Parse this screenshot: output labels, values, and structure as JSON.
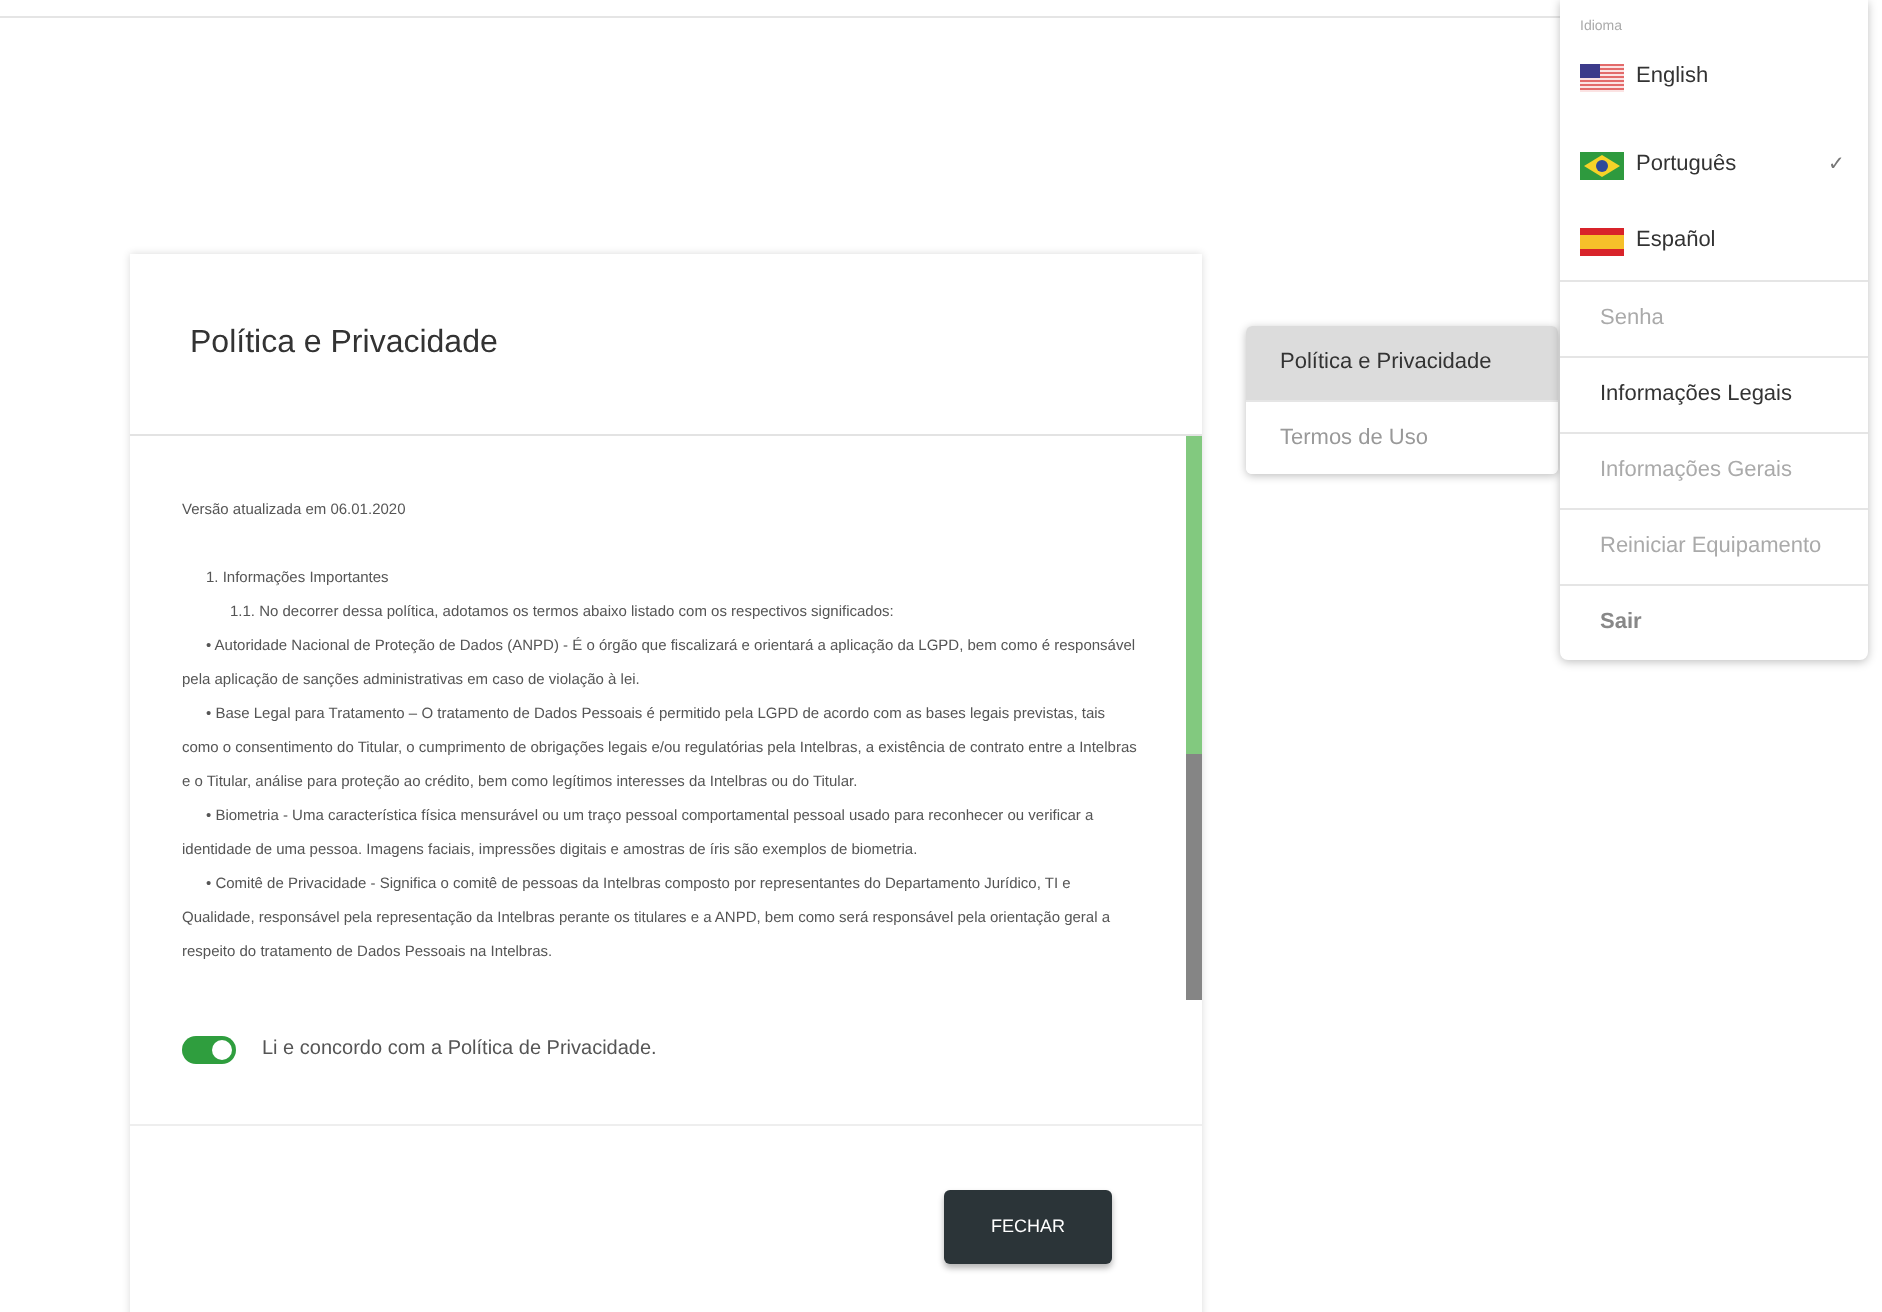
{
  "dialog": {
    "title": "Política e Privacidade",
    "paragraphs": [
      {
        "kind": "version",
        "text": "Versão atualizada em 06.01.2020"
      },
      {
        "kind": "heading",
        "text": "1. Informações Importantes"
      },
      {
        "kind": "subheading",
        "text": "1.1. No decorrer dessa política, adotamos os termos abaixo listado com os respectivos significados:"
      },
      {
        "kind": "bullet",
        "text": "• Autoridade Nacional de Proteção de Dados (ANPD) - É o órgão que fiscalizará e orientará a aplicação da LGPD, bem como é responsável pela aplicação de sanções administrativas em caso de violação à lei."
      },
      {
        "kind": "bullet",
        "text": "• Base Legal para Tratamento – O tratamento de Dados Pessoais é permitido pela LGPD de acordo com as bases legais previstas, tais como o consentimento do Titular, o cumprimento de obrigações legais e/ou regulatórias pela Intelbras, a existência de contrato entre a Intelbras e o Titular, análise para proteção ao crédito, bem como legítimos interesses da Intelbras ou do Titular."
      },
      {
        "kind": "bullet",
        "text": "• Biometria - Uma característica física mensurável ou um traço pessoal comportamental pessoal usado para reconhecer ou verificar a identidade de uma pessoa. Imagens faciais, impressões digitais e amostras de íris são exemplos de biometria."
      },
      {
        "kind": "bullet",
        "text": "• Comitê de Privacidade - Significa o comitê de pessoas da Intelbras composto por representantes do Departamento Jurídico, TI e Qualidade, responsável pela representação da Intelbras perante os titulares e a ANPD, bem como será responsável pela orientação geral a respeito do tratamento de Dados Pessoais na Intelbras."
      }
    ],
    "agree": {
      "label": "Li e concordo com a Política de Privacidade.",
      "on": true
    },
    "close_button": "FECHAR"
  },
  "submenu": [
    {
      "label": "Política e Privacidade",
      "selected": true
    },
    {
      "label": "Termos de Uso",
      "selected": false
    }
  ],
  "menu": {
    "section_label": "Idioma",
    "languages": [
      {
        "kind": "us",
        "label": "English",
        "selected": false
      },
      {
        "kind": "br",
        "label": "Português",
        "selected": true
      },
      {
        "kind": "es",
        "label": "Español",
        "selected": false
      }
    ],
    "check": "✓",
    "items": [
      {
        "kind": "item",
        "label": "Senha",
        "disabled": true
      },
      {
        "kind": "item",
        "label": "Informações Legais",
        "disabled": false
      },
      {
        "kind": "item",
        "label": "Informações Gerais",
        "disabled": true
      },
      {
        "kind": "item",
        "label": "Reiniciar Equipamento",
        "disabled": true
      },
      {
        "kind": "logout",
        "label": "Sair",
        "disabled": false
      }
    ]
  }
}
